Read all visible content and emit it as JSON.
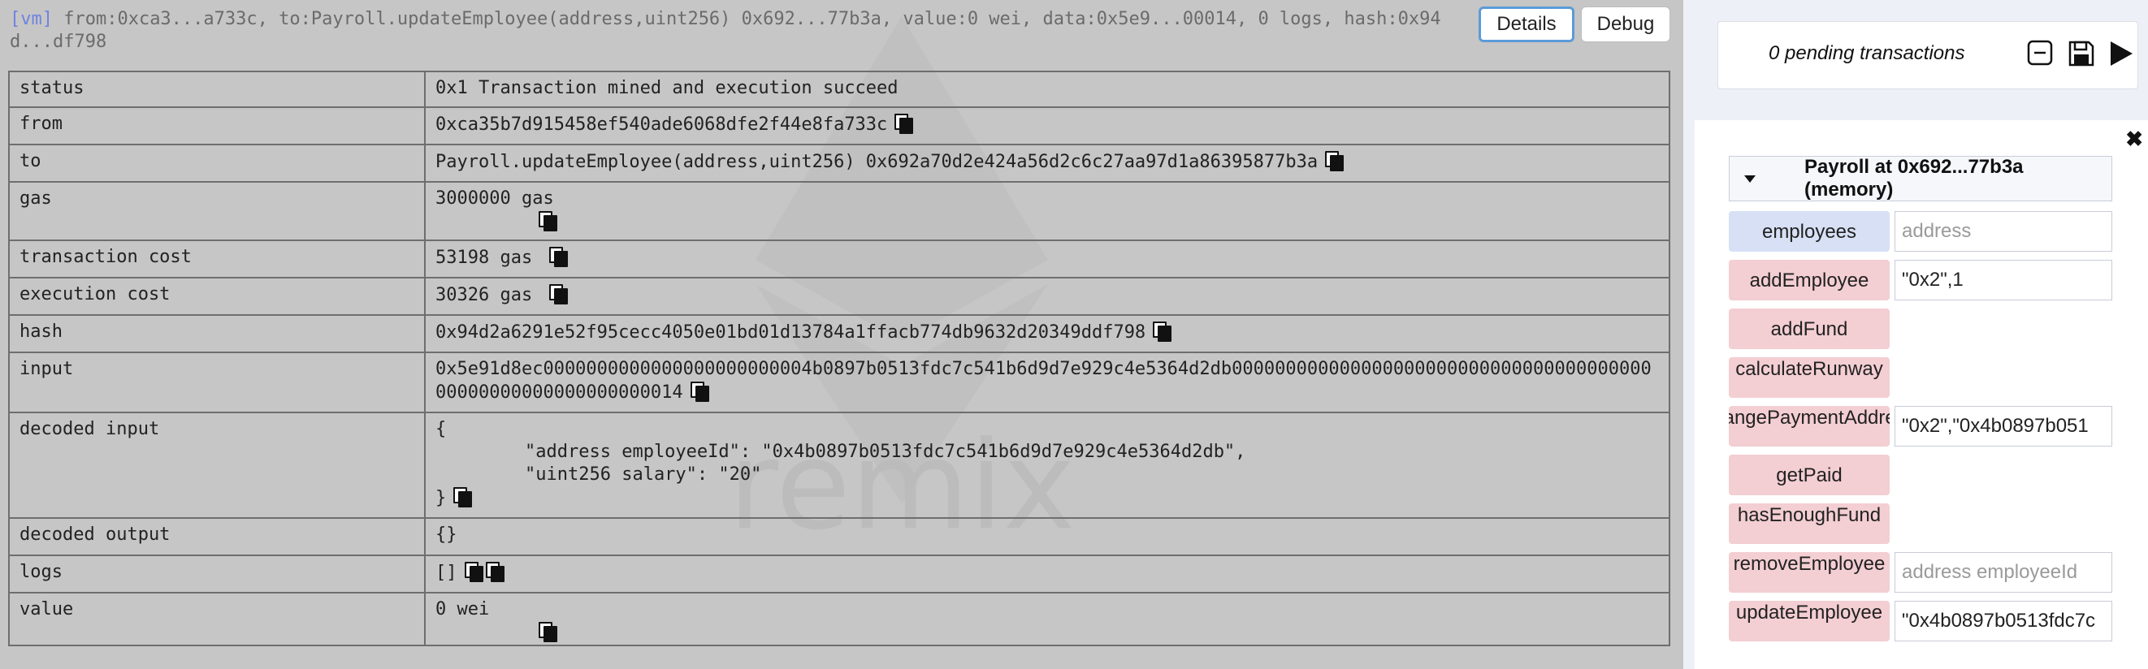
{
  "terminal": {
    "tag": "[vm]",
    "summary": " from:0xca3...a733c, to:Payroll.updateEmployee(address,uint256) 0x692...77b3a, value:0 wei, data:0x5e9...00014, 0 logs, hash:0x94d...df798",
    "details_label": "Details",
    "debug_label": "Debug",
    "watermark_text": "remix",
    "rows": {
      "status": {
        "key": "status",
        "value": "0x1 Transaction mined and execution succeed"
      },
      "from": {
        "key": "from",
        "value": "0xca35b7d915458ef540ade6068dfe2f44e8fa733c"
      },
      "to": {
        "key": "to",
        "value": "Payroll.updateEmployee(address,uint256) 0x692a70d2e424a56d2c6c27aa97d1a86395877b3a"
      },
      "gas": {
        "key": "gas",
        "value": "3000000 gas"
      },
      "transaction_cost": {
        "key": "transaction cost",
        "value": "53198 gas"
      },
      "execution_cost": {
        "key": "execution cost",
        "value": "30326 gas"
      },
      "hash": {
        "key": "hash",
        "value": "0x94d2a6291e52f95cecc4050e01bd01d13784a1ffacb774db9632d20349ddf798"
      },
      "input": {
        "key": "input",
        "value": "0x5e91d8ec0000000000000000000000004b0897b0513fdc7c541b6d9d7e929c4e5364d2db00000000000000000000000000000000000000000000000000000000000014"
      },
      "decoded_input": {
        "key": "decoded input",
        "open": "{",
        "line1": "\"address employeeId\": \"0x4b0897b0513fdc7c541b6d9d7e929c4e5364d2db\",",
        "line2": "\"uint256 salary\": \"20\"",
        "close": "}"
      },
      "decoded_output": {
        "key": "decoded output",
        "value": "{}"
      },
      "logs": {
        "key": "logs",
        "value": "[]"
      },
      "value": {
        "key": "value",
        "value": "0 wei"
      }
    }
  },
  "sidebar": {
    "pending": "0 pending transactions",
    "instance_title": "Payroll at 0x692...77b3a (memory)",
    "functions": [
      {
        "label": "employees",
        "kind": "call",
        "value": "",
        "placeholder": "address"
      },
      {
        "label": "addEmployee",
        "kind": "tx",
        "value": "\"0x2\",1",
        "placeholder": ""
      },
      {
        "label": "addFund",
        "kind": "tx"
      },
      {
        "label": "calculateRunway",
        "kind": "tx"
      },
      {
        "label": "changePaymentAddress",
        "kind": "tx",
        "value": "\"0x2\",\"0x4b0897b051",
        "placeholder": ""
      },
      {
        "label": "getPaid",
        "kind": "tx"
      },
      {
        "label": "hasEnoughFund",
        "kind": "tx"
      },
      {
        "label": "removeEmployee",
        "kind": "tx",
        "value": "",
        "placeholder": "address employeeId"
      },
      {
        "label": "updateEmployee",
        "kind": "tx",
        "value": "\"0x4b0897b0513fdc7c",
        "placeholder": ""
      }
    ],
    "colors": {
      "call": "#d7e0f5",
      "tx": "#f3ced2"
    }
  }
}
